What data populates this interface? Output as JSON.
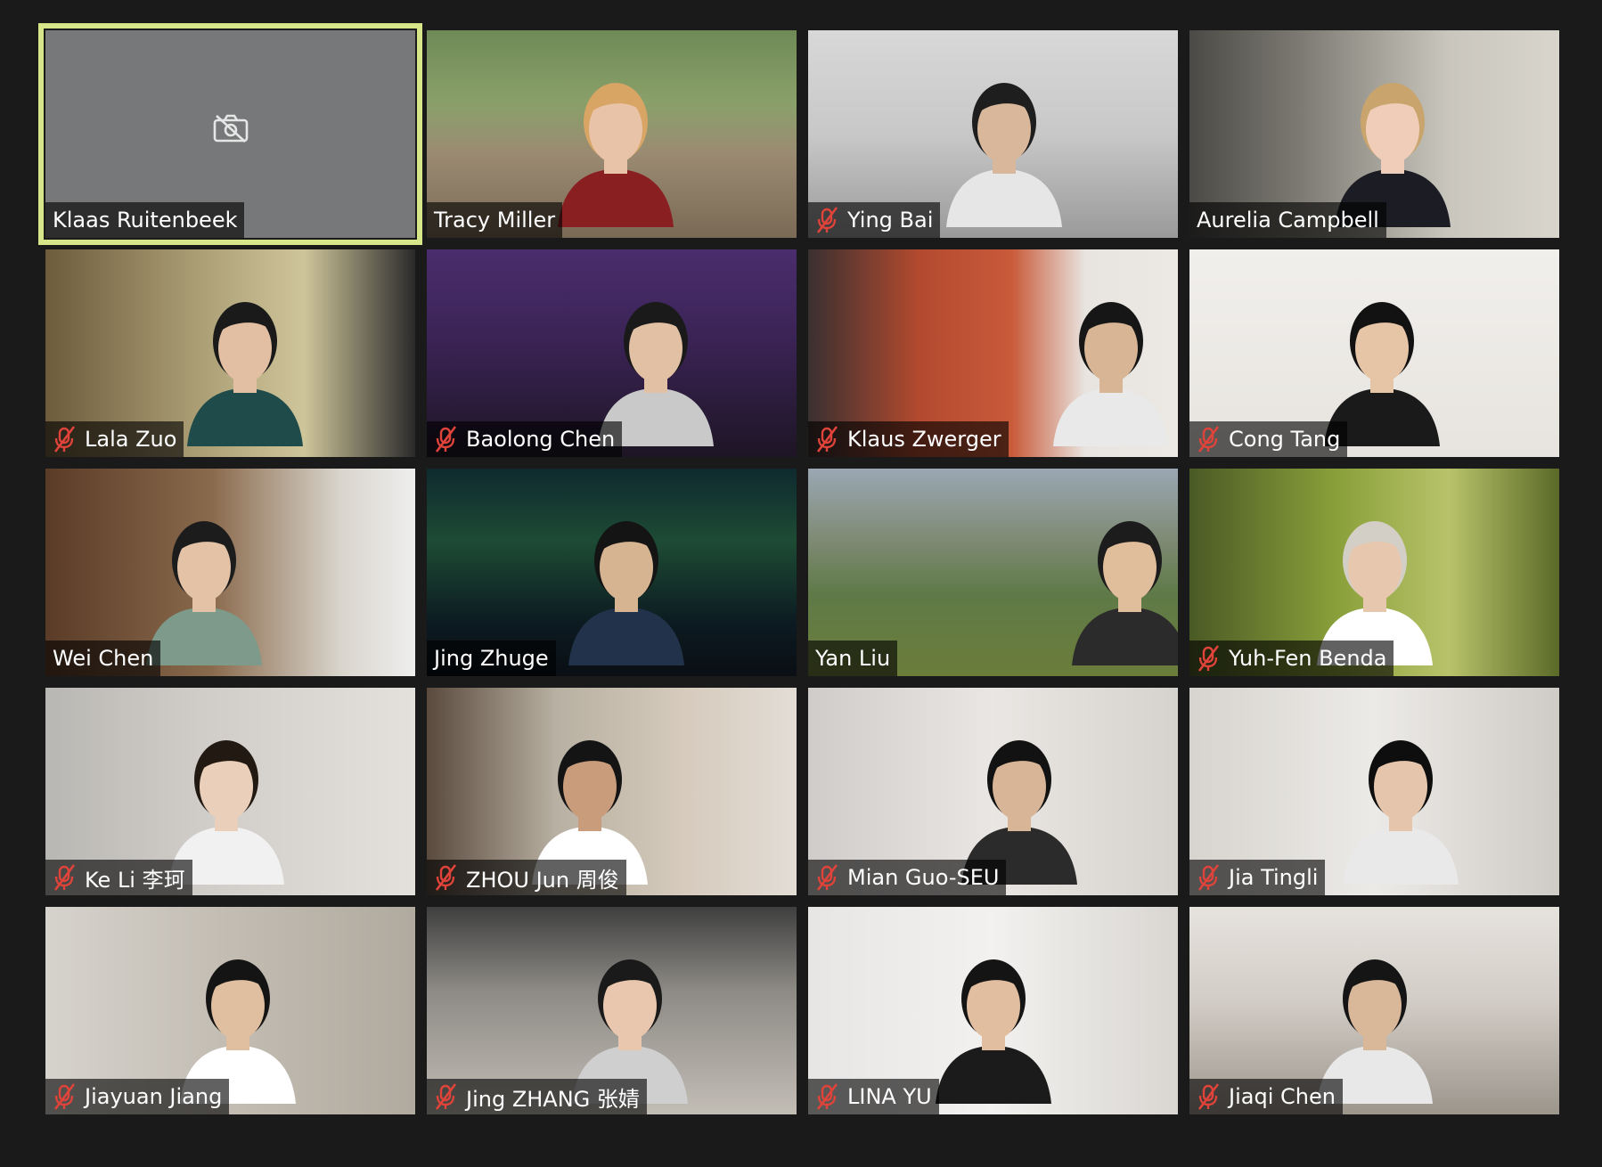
{
  "meeting": {
    "layout": "gallery-view",
    "active_speaker_color": "#d8e68a",
    "muted_icon_color": "#e0433a"
  },
  "participants": [
    {
      "name": "Klaas Ruitenbeek",
      "muted": false,
      "camera": false,
      "active": true
    },
    {
      "name": "Tracy Miller",
      "muted": false,
      "camera": true
    },
    {
      "name": "Ying Bai",
      "muted": true,
      "camera": true
    },
    {
      "name": "Aurelia Campbell",
      "muted": false,
      "camera": true
    },
    {
      "name": "Lala Zuo",
      "muted": true,
      "camera": true
    },
    {
      "name": "Baolong Chen",
      "muted": true,
      "camera": true
    },
    {
      "name": "Klaus Zwerger",
      "muted": true,
      "camera": true
    },
    {
      "name": "Cong Tang",
      "muted": true,
      "camera": true
    },
    {
      "name": "Wei Chen",
      "muted": false,
      "camera": true
    },
    {
      "name": "Jing Zhuge",
      "muted": false,
      "camera": true
    },
    {
      "name": "Yan Liu",
      "muted": false,
      "camera": true
    },
    {
      "name": "Yuh-Fen Benda",
      "muted": true,
      "camera": true
    },
    {
      "name": "Ke Li 李珂",
      "muted": true,
      "camera": true
    },
    {
      "name": "ZHOU Jun 周俊",
      "muted": true,
      "camera": true
    },
    {
      "name": "Mian Guo-SEU",
      "muted": true,
      "camera": true
    },
    {
      "name": "Jia Tingli",
      "muted": true,
      "camera": true
    },
    {
      "name": "Jiayuan Jiang",
      "muted": true,
      "camera": true
    },
    {
      "name": "Jing ZHANG 张婧",
      "muted": true,
      "camera": true
    },
    {
      "name": "LINA YU",
      "muted": true,
      "camera": true
    },
    {
      "name": "Jiaqi Chen",
      "muted": true,
      "camera": true
    }
  ]
}
